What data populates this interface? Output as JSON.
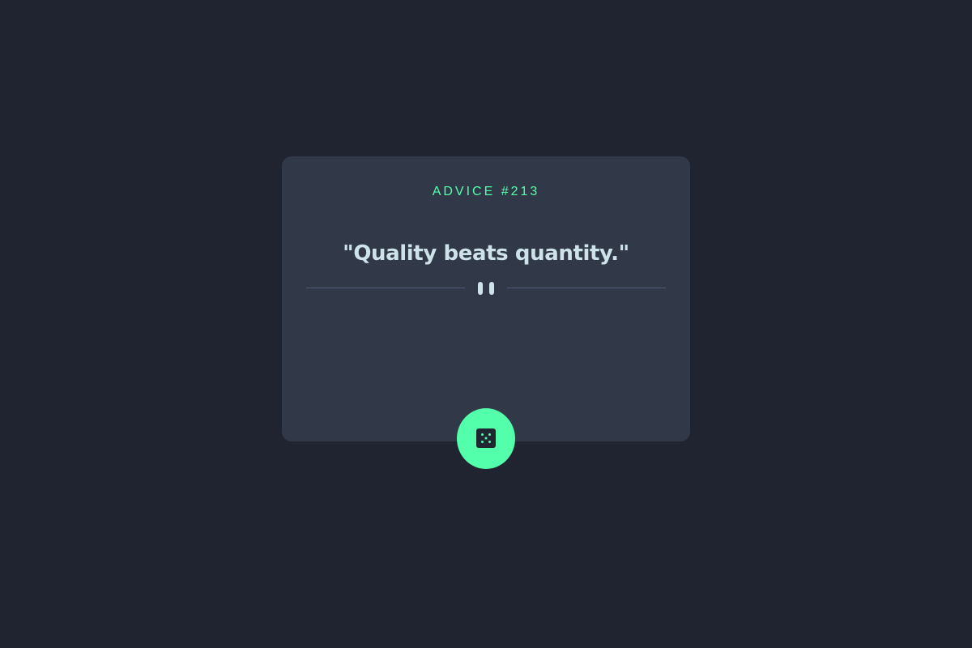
{
  "advice": {
    "id_label": "ADVICE #213",
    "quote": "\"Quality beats quantity.\""
  },
  "icons": {
    "divider": "pause-icon",
    "button": "dice-icon"
  },
  "colors": {
    "background": "#1f2430",
    "card": "#313848",
    "accent": "#53ffaa",
    "text": "#cee3e9",
    "divider": "#4f5d74"
  }
}
